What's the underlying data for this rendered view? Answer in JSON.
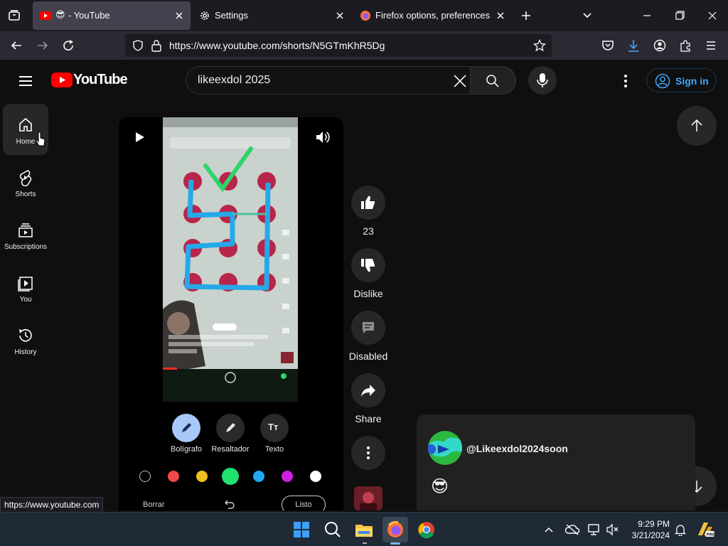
{
  "browser": {
    "tabs": [
      {
        "title": "- YouTube",
        "icon": "youtube-icon"
      },
      {
        "title": "Settings",
        "icon": "gear-icon"
      },
      {
        "title": "Firefox options, preferences and",
        "icon": "firefox-icon"
      }
    ],
    "url": "https://www.youtube.com/shorts/N5GTmKhR5Dg",
    "status_url": "https://www.youtube.com"
  },
  "youtube": {
    "logo_text": "YouTube",
    "search_value": "likeexdol 2025",
    "sign_in_label": "Sign in",
    "guide": [
      {
        "label": "Home",
        "icon": "home-icon"
      },
      {
        "label": "Shorts",
        "icon": "shorts-icon"
      },
      {
        "label": "Subscriptions",
        "icon": "subscriptions-icon"
      },
      {
        "label": "You",
        "icon": "you-icon"
      },
      {
        "label": "History",
        "icon": "history-icon"
      }
    ],
    "phone_overlay": {
      "tools": [
        {
          "label": "Bolígrafo"
        },
        {
          "label": "Resaltador"
        },
        {
          "label": "Texto"
        }
      ],
      "palette": [
        "#000000",
        "#f04848",
        "#f0c020",
        "#20e070",
        "#20a8f0",
        "#d020e0",
        "#ffffff"
      ],
      "bottom_left": "Borrar",
      "bottom_right": "Listo"
    },
    "actions": {
      "like_count": "23",
      "dislike_label": "Dislike",
      "comments_label": "Disabled",
      "share_label": "Share"
    },
    "comment": {
      "author": "@Likeexdol2024soon",
      "emoji": "😎"
    }
  },
  "taskbar": {
    "time": "9:29 PM",
    "date": "3/21/2024"
  }
}
